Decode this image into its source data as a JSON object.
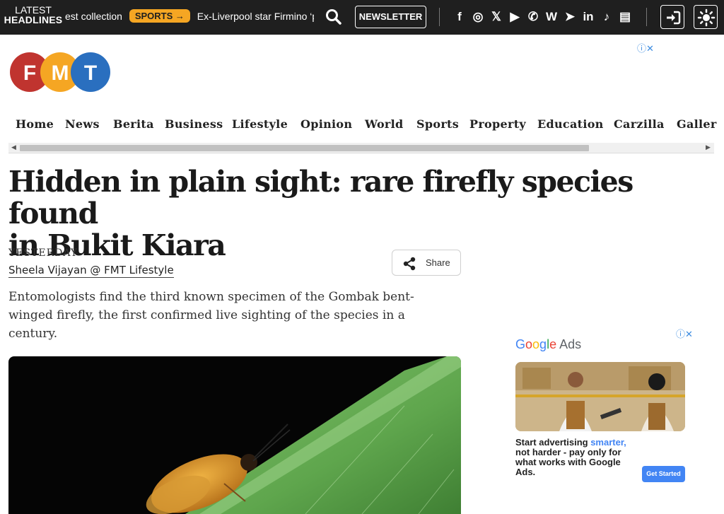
{
  "topbar": {
    "latest_line1": "LATEST",
    "latest_line2": "HEADLINES",
    "ticker_before": "est collection",
    "ticker_pill": "SPORTS →",
    "ticker_after": "Ex-Liverpool star Firmino ‘pu",
    "newsletter_label": "NEWSLETTER",
    "socials": [
      {
        "name": "facebook-icon",
        "glyph": "f"
      },
      {
        "name": "instagram-icon",
        "glyph": "◎"
      },
      {
        "name": "x-icon",
        "glyph": "𝕏"
      },
      {
        "name": "youtube-icon",
        "glyph": "▶"
      },
      {
        "name": "whatsapp-icon",
        "glyph": "✆"
      },
      {
        "name": "wikipedia-icon",
        "glyph": "W"
      },
      {
        "name": "telegram-icon",
        "glyph": "➤"
      },
      {
        "name": "linkedin-icon",
        "glyph": "in"
      },
      {
        "name": "tiktok-icon",
        "glyph": "♪"
      },
      {
        "name": "google-news-icon",
        "glyph": "▤"
      }
    ]
  },
  "brand": {
    "logo_letters": [
      "F",
      "M",
      "T"
    ],
    "logo_colors": [
      "#c0342f",
      "#f5a623",
      "#2a6fbf"
    ],
    "adchoices_label": "ⓘ✕"
  },
  "nav": {
    "items": [
      "Home",
      "News",
      "Berita",
      "Business",
      "Lifestyle",
      "Opinion",
      "World",
      "Sports",
      "Property",
      "Education",
      "Carzilla",
      "Galler"
    ]
  },
  "article": {
    "headline_line1": "Hidden in plain sight: rare firefly species found",
    "headline_line2": "in Bukit Kiara",
    "date": "YESTERDAY",
    "author": "Sheela Vijayan @ FMT Lifestyle",
    "share_label": "Share",
    "standfirst": "Entomologists find the third known specimen of the Gombak bent-winged firefly, the first confirmed live sighting of the species in a century."
  },
  "ad": {
    "adchoices_label": "ⓘ✕",
    "brand_google": "Google",
    "brand_ads": "Ads",
    "copy_part1": "Start advertising ",
    "copy_highlight": "smarter,",
    "copy_part2": " not harder - pay only for what works with Google Ads.",
    "cta": "Get Started"
  },
  "colors": {
    "topbar_bg": "#1f1f1f",
    "pill": "#f5a623",
    "google_blue": "#4285f4"
  }
}
